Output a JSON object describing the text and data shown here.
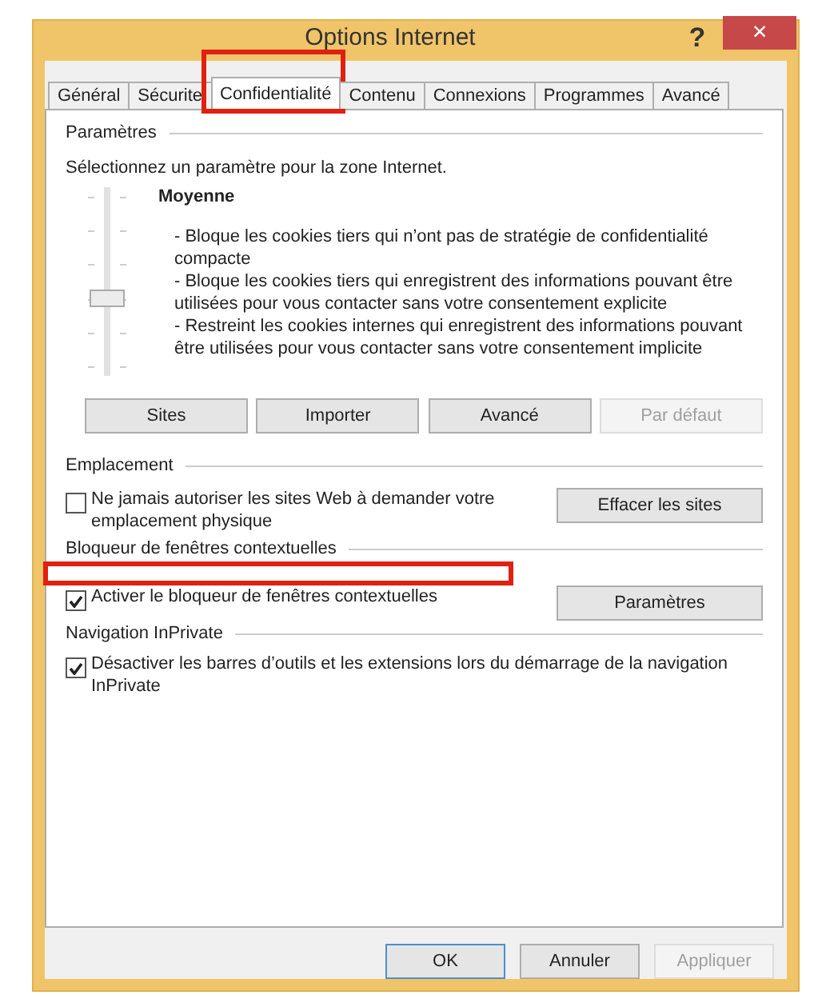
{
  "window": {
    "title": "Options Internet",
    "help": "?",
    "close": "×"
  },
  "tabs": [
    {
      "label": "Général",
      "selected": false
    },
    {
      "label": "Sécurite",
      "selected": false
    },
    {
      "label": "Confidentialité",
      "selected": true
    },
    {
      "label": "Contenu",
      "selected": false
    },
    {
      "label": "Connexions",
      "selected": false
    },
    {
      "label": "Programmes",
      "selected": false
    },
    {
      "label": "Avancé",
      "selected": false
    }
  ],
  "settings": {
    "heading": "Paramètres",
    "intro": "Sélectionnez un paramètre pour la zone Internet.",
    "slider": {
      "level": 0.4
    },
    "level_name": "Moyenne",
    "description": [
      "- Bloque les cookies tiers qui n’ont pas de stratégie de confidentialité compacte",
      "- Bloque les cookies tiers qui enregistrent des informations pouvant être utilisées pour vous contacter sans votre consentement explicite",
      "- Restreint les cookies internes qui enregistrent des informations pouvant être utilisées pour vous contacter sans votre consentement implicite"
    ],
    "buttons": [
      {
        "label": "Sites",
        "disabled": false
      },
      {
        "label": "Importer",
        "disabled": false
      },
      {
        "label": "Avancé",
        "disabled": false
      },
      {
        "label": "Par défaut",
        "disabled": true
      }
    ]
  },
  "location": {
    "heading": "Emplacement",
    "checkbox": {
      "label": "Ne jamais autoriser les sites Web à demander votre emplacement physique",
      "checked": false
    },
    "button": "Effacer les sites"
  },
  "popup": {
    "heading": "Bloqueur de fenêtres contextuelles",
    "checkbox": {
      "label": "Activer le bloqueur de fenêtres contextuelles",
      "checked": true
    },
    "button": "Paramètres"
  },
  "inprivate": {
    "heading": "Navigation InPrivate",
    "checkbox": {
      "label": "Désactiver les barres d’outils et les extensions lors du démarrage de la navigation InPrivate",
      "checked": true
    }
  },
  "footer": [
    {
      "label": "OK",
      "default": true,
      "disabled": false
    },
    {
      "label": "Annuler",
      "default": false,
      "disabled": false
    },
    {
      "label": "Appliquer",
      "default": false,
      "disabled": true
    }
  ]
}
